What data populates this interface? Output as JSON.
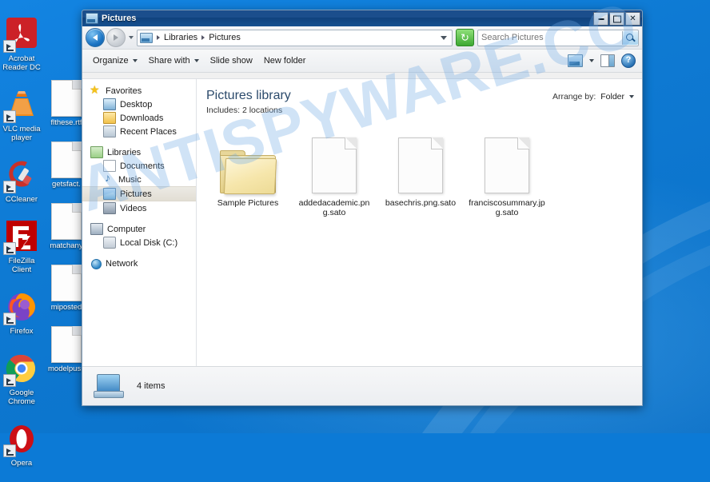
{
  "desktop": {
    "icons": [
      {
        "label": "Acrobat Reader DC",
        "type": "app",
        "icon": "acrobat-icon",
        "color": "#cc2127"
      },
      {
        "label": "VLC media player",
        "type": "app",
        "icon": "vlc-cone-icon",
        "color": "#e8730c"
      },
      {
        "label": "CCleaner",
        "type": "app",
        "icon": "ccleaner-icon",
        "color": "#c8312a"
      },
      {
        "label": "flthese.rtf",
        "type": "doc",
        "icon": "document-icon",
        "color": "#fdfdfd"
      },
      {
        "label": "FileZilla Client",
        "type": "app",
        "icon": "filezilla-icon",
        "color": "#bf0000"
      },
      {
        "label": "getsfact.",
        "type": "doc",
        "icon": "document-icon",
        "color": "#fdfdfd"
      },
      {
        "label": "Firefox",
        "type": "app",
        "icon": "firefox-icon",
        "color": "#e66000"
      },
      {
        "label": "matchany",
        "type": "doc",
        "icon": "document-icon",
        "color": "#fdfdfd"
      },
      {
        "label": "Google Chrome",
        "type": "app",
        "icon": "chrome-icon",
        "color": "#4285f4"
      },
      {
        "label": "miposted",
        "type": "doc",
        "icon": "document-icon",
        "color": "#fdfdfd"
      },
      {
        "label": "Opera",
        "type": "app",
        "icon": "opera-icon",
        "color": "#cc0f16"
      },
      {
        "label": "modelpuss",
        "type": "doc",
        "icon": "document-icon",
        "color": "#fdfdfd"
      }
    ]
  },
  "watermark": "ANTISPYWARE.CO",
  "window": {
    "title": "Pictures",
    "controls": {
      "minimize": "–",
      "maximize": "□",
      "close": "✕"
    },
    "address": {
      "back_tooltip": "Back",
      "forward_tooltip": "Forward",
      "crumbs": [
        "Libraries",
        "Pictures"
      ],
      "refresh_glyph": "↻"
    },
    "search": {
      "placeholder": "Search Pictures",
      "value": ""
    },
    "toolbar": {
      "organize": "Organize",
      "share_with": "Share with",
      "slide_show": "Slide show",
      "new_folder": "New folder",
      "help_glyph": "?"
    },
    "navigation": {
      "groups": [
        {
          "header": {
            "label": "Favorites",
            "icon": "star-icon"
          },
          "items": [
            {
              "label": "Desktop",
              "icon": "desktop-icon"
            },
            {
              "label": "Downloads",
              "icon": "downloads-icon"
            },
            {
              "label": "Recent Places",
              "icon": "recent-places-icon"
            }
          ]
        },
        {
          "header": {
            "label": "Libraries",
            "icon": "libraries-icon"
          },
          "items": [
            {
              "label": "Documents",
              "icon": "documents-icon"
            },
            {
              "label": "Music",
              "icon": "music-icon"
            },
            {
              "label": "Pictures",
              "icon": "pictures-icon",
              "selected": true
            },
            {
              "label": "Videos",
              "icon": "videos-icon"
            }
          ]
        },
        {
          "header": {
            "label": "Computer",
            "icon": "computer-icon"
          },
          "items": [
            {
              "label": "Local Disk (C:)",
              "icon": "local-disk-icon"
            }
          ]
        },
        {
          "header": {
            "label": "Network",
            "icon": "network-icon"
          },
          "items": []
        }
      ]
    },
    "library": {
      "title": "Pictures library",
      "subtitle": "Includes:  2 locations",
      "arrange_label": "Arrange by:",
      "arrange_value": "Folder"
    },
    "items": [
      {
        "name": "Sample Pictures",
        "kind": "folder"
      },
      {
        "name": "addedacademic.png.sato",
        "kind": "file"
      },
      {
        "name": "basechris.png.sato",
        "kind": "file"
      },
      {
        "name": "franciscosummary.jpg.sato",
        "kind": "file"
      }
    ],
    "status": {
      "text": "4 items",
      "icon": "computer-icon"
    }
  }
}
